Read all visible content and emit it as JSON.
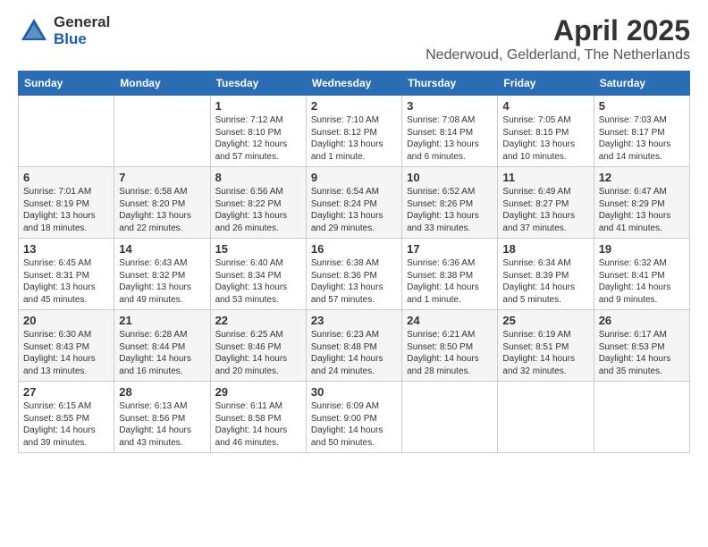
{
  "logo": {
    "general": "General",
    "blue": "Blue"
  },
  "title": {
    "month": "April 2025",
    "location": "Nederwoud, Gelderland, The Netherlands"
  },
  "headers": [
    "Sunday",
    "Monday",
    "Tuesday",
    "Wednesday",
    "Thursday",
    "Friday",
    "Saturday"
  ],
  "weeks": [
    [
      {
        "date": "",
        "sunrise": "",
        "sunset": "",
        "daylight": ""
      },
      {
        "date": "",
        "sunrise": "",
        "sunset": "",
        "daylight": ""
      },
      {
        "date": "1",
        "sunrise": "Sunrise: 7:12 AM",
        "sunset": "Sunset: 8:10 PM",
        "daylight": "Daylight: 12 hours and 57 minutes."
      },
      {
        "date": "2",
        "sunrise": "Sunrise: 7:10 AM",
        "sunset": "Sunset: 8:12 PM",
        "daylight": "Daylight: 13 hours and 1 minute."
      },
      {
        "date": "3",
        "sunrise": "Sunrise: 7:08 AM",
        "sunset": "Sunset: 8:14 PM",
        "daylight": "Daylight: 13 hours and 6 minutes."
      },
      {
        "date": "4",
        "sunrise": "Sunrise: 7:05 AM",
        "sunset": "Sunset: 8:15 PM",
        "daylight": "Daylight: 13 hours and 10 minutes."
      },
      {
        "date": "5",
        "sunrise": "Sunrise: 7:03 AM",
        "sunset": "Sunset: 8:17 PM",
        "daylight": "Daylight: 13 hours and 14 minutes."
      }
    ],
    [
      {
        "date": "6",
        "sunrise": "Sunrise: 7:01 AM",
        "sunset": "Sunset: 8:19 PM",
        "daylight": "Daylight: 13 hours and 18 minutes."
      },
      {
        "date": "7",
        "sunrise": "Sunrise: 6:58 AM",
        "sunset": "Sunset: 8:20 PM",
        "daylight": "Daylight: 13 hours and 22 minutes."
      },
      {
        "date": "8",
        "sunrise": "Sunrise: 6:56 AM",
        "sunset": "Sunset: 8:22 PM",
        "daylight": "Daylight: 13 hours and 26 minutes."
      },
      {
        "date": "9",
        "sunrise": "Sunrise: 6:54 AM",
        "sunset": "Sunset: 8:24 PM",
        "daylight": "Daylight: 13 hours and 29 minutes."
      },
      {
        "date": "10",
        "sunrise": "Sunrise: 6:52 AM",
        "sunset": "Sunset: 8:26 PM",
        "daylight": "Daylight: 13 hours and 33 minutes."
      },
      {
        "date": "11",
        "sunrise": "Sunrise: 6:49 AM",
        "sunset": "Sunset: 8:27 PM",
        "daylight": "Daylight: 13 hours and 37 minutes."
      },
      {
        "date": "12",
        "sunrise": "Sunrise: 6:47 AM",
        "sunset": "Sunset: 8:29 PM",
        "daylight": "Daylight: 13 hours and 41 minutes."
      }
    ],
    [
      {
        "date": "13",
        "sunrise": "Sunrise: 6:45 AM",
        "sunset": "Sunset: 8:31 PM",
        "daylight": "Daylight: 13 hours and 45 minutes."
      },
      {
        "date": "14",
        "sunrise": "Sunrise: 6:43 AM",
        "sunset": "Sunset: 8:32 PM",
        "daylight": "Daylight: 13 hours and 49 minutes."
      },
      {
        "date": "15",
        "sunrise": "Sunrise: 6:40 AM",
        "sunset": "Sunset: 8:34 PM",
        "daylight": "Daylight: 13 hours and 53 minutes."
      },
      {
        "date": "16",
        "sunrise": "Sunrise: 6:38 AM",
        "sunset": "Sunset: 8:36 PM",
        "daylight": "Daylight: 13 hours and 57 minutes."
      },
      {
        "date": "17",
        "sunrise": "Sunrise: 6:36 AM",
        "sunset": "Sunset: 8:38 PM",
        "daylight": "Daylight: 14 hours and 1 minute."
      },
      {
        "date": "18",
        "sunrise": "Sunrise: 6:34 AM",
        "sunset": "Sunset: 8:39 PM",
        "daylight": "Daylight: 14 hours and 5 minutes."
      },
      {
        "date": "19",
        "sunrise": "Sunrise: 6:32 AM",
        "sunset": "Sunset: 8:41 PM",
        "daylight": "Daylight: 14 hours and 9 minutes."
      }
    ],
    [
      {
        "date": "20",
        "sunrise": "Sunrise: 6:30 AM",
        "sunset": "Sunset: 8:43 PM",
        "daylight": "Daylight: 14 hours and 13 minutes."
      },
      {
        "date": "21",
        "sunrise": "Sunrise: 6:28 AM",
        "sunset": "Sunset: 8:44 PM",
        "daylight": "Daylight: 14 hours and 16 minutes."
      },
      {
        "date": "22",
        "sunrise": "Sunrise: 6:25 AM",
        "sunset": "Sunset: 8:46 PM",
        "daylight": "Daylight: 14 hours and 20 minutes."
      },
      {
        "date": "23",
        "sunrise": "Sunrise: 6:23 AM",
        "sunset": "Sunset: 8:48 PM",
        "daylight": "Daylight: 14 hours and 24 minutes."
      },
      {
        "date": "24",
        "sunrise": "Sunrise: 6:21 AM",
        "sunset": "Sunset: 8:50 PM",
        "daylight": "Daylight: 14 hours and 28 minutes."
      },
      {
        "date": "25",
        "sunrise": "Sunrise: 6:19 AM",
        "sunset": "Sunset: 8:51 PM",
        "daylight": "Daylight: 14 hours and 32 minutes."
      },
      {
        "date": "26",
        "sunrise": "Sunrise: 6:17 AM",
        "sunset": "Sunset: 8:53 PM",
        "daylight": "Daylight: 14 hours and 35 minutes."
      }
    ],
    [
      {
        "date": "27",
        "sunrise": "Sunrise: 6:15 AM",
        "sunset": "Sunset: 8:55 PM",
        "daylight": "Daylight: 14 hours and 39 minutes."
      },
      {
        "date": "28",
        "sunrise": "Sunrise: 6:13 AM",
        "sunset": "Sunset: 8:56 PM",
        "daylight": "Daylight: 14 hours and 43 minutes."
      },
      {
        "date": "29",
        "sunrise": "Sunrise: 6:11 AM",
        "sunset": "Sunset: 8:58 PM",
        "daylight": "Daylight: 14 hours and 46 minutes."
      },
      {
        "date": "30",
        "sunrise": "Sunrise: 6:09 AM",
        "sunset": "Sunset: 9:00 PM",
        "daylight": "Daylight: 14 hours and 50 minutes."
      },
      {
        "date": "",
        "sunrise": "",
        "sunset": "",
        "daylight": ""
      },
      {
        "date": "",
        "sunrise": "",
        "sunset": "",
        "daylight": ""
      },
      {
        "date": "",
        "sunrise": "",
        "sunset": "",
        "daylight": ""
      }
    ]
  ]
}
